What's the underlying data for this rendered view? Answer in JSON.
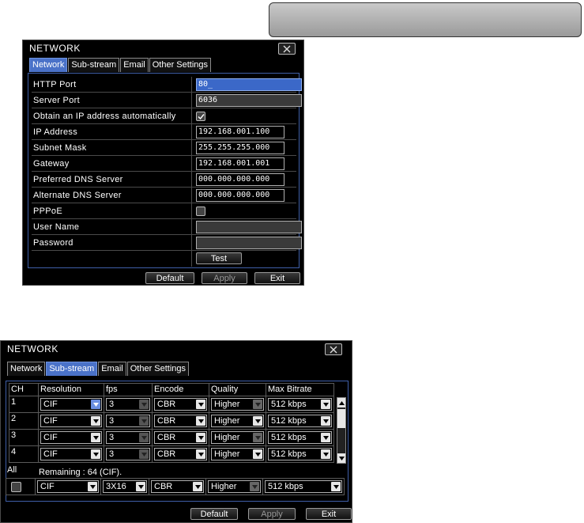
{
  "network_dialog": {
    "title": "NETWORK",
    "tabs": [
      "Network",
      "Sub-stream",
      "Email",
      "Other Settings"
    ],
    "active_tab": 0,
    "fields": {
      "http_port": {
        "label": "HTTP Port",
        "value": "80_"
      },
      "server_port": {
        "label": "Server Port",
        "value": "6036"
      },
      "obtain_ip": {
        "label": "Obtain an IP address automatically",
        "checked": true
      },
      "ip_address": {
        "label": "IP Address",
        "value": "192.168.001.100"
      },
      "subnet_mask": {
        "label": "Subnet Mask",
        "value": "255.255.255.000"
      },
      "gateway": {
        "label": "Gateway",
        "value": "192.168.001.001"
      },
      "preferred_dns": {
        "label": "Preferred DNS Server",
        "value": "000.000.000.000"
      },
      "alternate_dns": {
        "label": "Alternate DNS Server",
        "value": "000.000.000.000"
      },
      "pppoe": {
        "label": "PPPoE",
        "checked": false
      },
      "user_name": {
        "label": "User Name",
        "value": ""
      },
      "password": {
        "label": "Password",
        "value": ""
      }
    },
    "test_label": "Test",
    "buttons": {
      "default": "Default",
      "apply": "Apply",
      "exit": "Exit"
    }
  },
  "substream_dialog": {
    "title": "NETWORK",
    "tabs": [
      "Network",
      "Sub-stream",
      "Email",
      "Other Settings"
    ],
    "active_tab": 1,
    "columns": [
      "CH",
      "Resolution",
      "fps",
      "Encode",
      "Quality",
      "Max Bitrate"
    ],
    "rows": [
      {
        "ch": "1",
        "resolution": "CIF",
        "fps": "3",
        "encode": "CBR",
        "quality": "Higher",
        "bitrate": "512 kbps"
      },
      {
        "ch": "2",
        "resolution": "CIF",
        "fps": "3",
        "encode": "CBR",
        "quality": "Higher",
        "bitrate": "512 kbps"
      },
      {
        "ch": "3",
        "resolution": "CIF",
        "fps": "3",
        "encode": "CBR",
        "quality": "Higher",
        "bitrate": "512 kbps"
      },
      {
        "ch": "4",
        "resolution": "CIF",
        "fps": "3",
        "encode": "CBR",
        "quality": "Higher",
        "bitrate": "512 kbps"
      }
    ],
    "all_label": "All",
    "remaining_text": "Remaining : 64 (CIF).",
    "all_row": {
      "resolution": "CIF",
      "fps": "3X16",
      "encode": "CBR",
      "quality": "Higher",
      "bitrate": "512 kbps"
    },
    "buttons": {
      "default": "Default",
      "apply": "Apply",
      "exit": "Exit"
    }
  },
  "colors": {
    "accent": "#4a72c8",
    "panel_border": "#3f5fa8",
    "background": "#000000"
  }
}
